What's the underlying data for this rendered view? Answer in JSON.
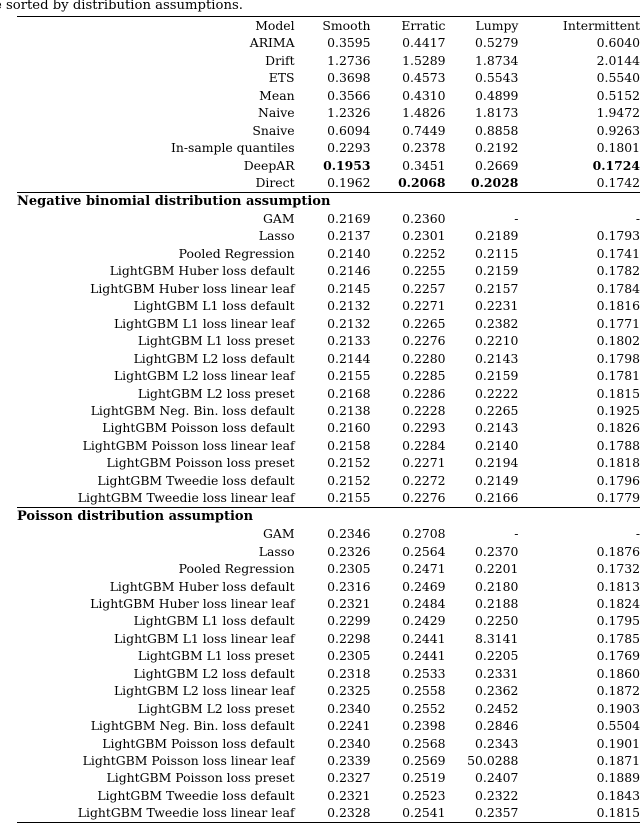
{
  "caption": {
    "text": "e sorted by distribution assumptions."
  },
  "table": {
    "columns": [
      {
        "key": "model",
        "label": "Model",
        "align": "right"
      },
      {
        "key": "smooth",
        "label": "Smooth",
        "align": "right"
      },
      {
        "key": "erratic",
        "label": "Erratic",
        "align": "right"
      },
      {
        "key": "lumpy",
        "label": "Lumpy",
        "align": "right"
      },
      {
        "key": "intermittent",
        "label": "Intermittent",
        "align": "right"
      }
    ],
    "sections": [
      {
        "heading": null,
        "rows": [
          {
            "model": "ARIMA",
            "smooth": "0.3595",
            "erratic": "0.4417",
            "lumpy": "0.5279",
            "intermittent": "0.6040",
            "bold": []
          },
          {
            "model": "Drift",
            "smooth": "1.2736",
            "erratic": "1.5289",
            "lumpy": "1.8734",
            "intermittent": "2.0144",
            "bold": []
          },
          {
            "model": "ETS",
            "smooth": "0.3698",
            "erratic": "0.4573",
            "lumpy": "0.5543",
            "intermittent": "0.5540",
            "bold": []
          },
          {
            "model": "Mean",
            "smooth": "0.3566",
            "erratic": "0.4310",
            "lumpy": "0.4899",
            "intermittent": "0.5152",
            "bold": []
          },
          {
            "model": "Naive",
            "smooth": "1.2326",
            "erratic": "1.4826",
            "lumpy": "1.8173",
            "intermittent": "1.9472",
            "bold": []
          },
          {
            "model": "Snaive",
            "smooth": "0.6094",
            "erratic": "0.7449",
            "lumpy": "0.8858",
            "intermittent": "0.9263",
            "bold": []
          },
          {
            "model": "In-sample quantiles",
            "smooth": "0.2293",
            "erratic": "0.2378",
            "lumpy": "0.2192",
            "intermittent": "0.1801",
            "bold": []
          },
          {
            "model": "DeepAR",
            "smooth": "0.1953",
            "erratic": "0.3451",
            "lumpy": "0.2669",
            "intermittent": "0.1724",
            "bold": [
              "smooth",
              "intermittent"
            ]
          },
          {
            "model": "Direct",
            "smooth": "0.1962",
            "erratic": "0.2068",
            "lumpy": "0.2028",
            "intermittent": "0.1742",
            "bold": [
              "erratic",
              "lumpy"
            ]
          }
        ]
      },
      {
        "heading": "Negative binomial distribution assumption",
        "rows": [
          {
            "model": "GAM",
            "smooth": "0.2169",
            "erratic": "0.2360",
            "lumpy": "-",
            "intermittent": "-",
            "bold": []
          },
          {
            "model": "Lasso",
            "smooth": "0.2137",
            "erratic": "0.2301",
            "lumpy": "0.2189",
            "intermittent": "0.1793",
            "bold": []
          },
          {
            "model": "Pooled Regression",
            "smooth": "0.2140",
            "erratic": "0.2252",
            "lumpy": "0.2115",
            "intermittent": "0.1741",
            "bold": []
          },
          {
            "model": "LightGBM Huber loss default",
            "smooth": "0.2146",
            "erratic": "0.2255",
            "lumpy": "0.2159",
            "intermittent": "0.1782",
            "bold": []
          },
          {
            "model": "LightGBM Huber loss linear leaf",
            "smooth": "0.2145",
            "erratic": "0.2257",
            "lumpy": "0.2157",
            "intermittent": "0.1784",
            "bold": []
          },
          {
            "model": "LightGBM L1 loss default",
            "smooth": "0.2132",
            "erratic": "0.2271",
            "lumpy": "0.2231",
            "intermittent": "0.1816",
            "bold": []
          },
          {
            "model": "LightGBM L1 loss linear leaf",
            "smooth": "0.2132",
            "erratic": "0.2265",
            "lumpy": "0.2382",
            "intermittent": "0.1771",
            "bold": []
          },
          {
            "model": "LightGBM L1 loss preset",
            "smooth": "0.2133",
            "erratic": "0.2276",
            "lumpy": "0.2210",
            "intermittent": "0.1802",
            "bold": []
          },
          {
            "model": "LightGBM L2 loss default",
            "smooth": "0.2144",
            "erratic": "0.2280",
            "lumpy": "0.2143",
            "intermittent": "0.1798",
            "bold": []
          },
          {
            "model": "LightGBM L2 loss linear leaf",
            "smooth": "0.2155",
            "erratic": "0.2285",
            "lumpy": "0.2159",
            "intermittent": "0.1781",
            "bold": []
          },
          {
            "model": "LightGBM L2 loss preset",
            "smooth": "0.2168",
            "erratic": "0.2286",
            "lumpy": "0.2222",
            "intermittent": "0.1815",
            "bold": []
          },
          {
            "model": "LightGBM Neg. Bin. loss default",
            "smooth": "0.2138",
            "erratic": "0.2228",
            "lumpy": "0.2265",
            "intermittent": "0.1925",
            "bold": []
          },
          {
            "model": "LightGBM Poisson loss default",
            "smooth": "0.2160",
            "erratic": "0.2293",
            "lumpy": "0.2143",
            "intermittent": "0.1826",
            "bold": []
          },
          {
            "model": "LightGBM Poisson loss linear leaf",
            "smooth": "0.2158",
            "erratic": "0.2284",
            "lumpy": "0.2140",
            "intermittent": "0.1788",
            "bold": []
          },
          {
            "model": "LightGBM Poisson loss preset",
            "smooth": "0.2152",
            "erratic": "0.2271",
            "lumpy": "0.2194",
            "intermittent": "0.1818",
            "bold": []
          },
          {
            "model": "LightGBM Tweedie loss default",
            "smooth": "0.2152",
            "erratic": "0.2272",
            "lumpy": "0.2149",
            "intermittent": "0.1796",
            "bold": []
          },
          {
            "model": "LightGBM Tweedie loss linear leaf",
            "smooth": "0.2155",
            "erratic": "0.2276",
            "lumpy": "0.2166",
            "intermittent": "0.1779",
            "bold": []
          }
        ]
      },
      {
        "heading": "Poisson distribution assumption",
        "rows": [
          {
            "model": "GAM",
            "smooth": "0.2346",
            "erratic": "0.2708",
            "lumpy": "-",
            "intermittent": "-",
            "bold": []
          },
          {
            "model": "Lasso",
            "smooth": "0.2326",
            "erratic": "0.2564",
            "lumpy": "0.2370",
            "intermittent": "0.1876",
            "bold": []
          },
          {
            "model": "Pooled Regression",
            "smooth": "0.2305",
            "erratic": "0.2471",
            "lumpy": "0.2201",
            "intermittent": "0.1732",
            "bold": []
          },
          {
            "model": "LightGBM Huber loss default",
            "smooth": "0.2316",
            "erratic": "0.2469",
            "lumpy": "0.2180",
            "intermittent": "0.1813",
            "bold": []
          },
          {
            "model": "LightGBM Huber loss linear leaf",
            "smooth": "0.2321",
            "erratic": "0.2484",
            "lumpy": "0.2188",
            "intermittent": "0.1824",
            "bold": []
          },
          {
            "model": "LightGBM L1 loss default",
            "smooth": "0.2299",
            "erratic": "0.2429",
            "lumpy": "0.2250",
            "intermittent": "0.1795",
            "bold": []
          },
          {
            "model": "LightGBM L1 loss linear leaf",
            "smooth": "0.2298",
            "erratic": "0.2441",
            "lumpy": "8.3141",
            "intermittent": "0.1785",
            "bold": []
          },
          {
            "model": "LightGBM L1 loss preset",
            "smooth": "0.2305",
            "erratic": "0.2441",
            "lumpy": "0.2205",
            "intermittent": "0.1769",
            "bold": []
          },
          {
            "model": "LightGBM L2 loss default",
            "smooth": "0.2318",
            "erratic": "0.2533",
            "lumpy": "0.2331",
            "intermittent": "0.1860",
            "bold": []
          },
          {
            "model": "LightGBM L2 loss linear leaf",
            "smooth": "0.2325",
            "erratic": "0.2558",
            "lumpy": "0.2362",
            "intermittent": "0.1872",
            "bold": []
          },
          {
            "model": "LightGBM L2 loss preset",
            "smooth": "0.2340",
            "erratic": "0.2552",
            "lumpy": "0.2452",
            "intermittent": "0.1903",
            "bold": []
          },
          {
            "model": "LightGBM Neg. Bin. loss default",
            "smooth": "0.2241",
            "erratic": "0.2398",
            "lumpy": "0.2846",
            "intermittent": "0.5504",
            "bold": []
          },
          {
            "model": "LightGBM Poisson loss default",
            "smooth": "0.2340",
            "erratic": "0.2568",
            "lumpy": "0.2343",
            "intermittent": "0.1901",
            "bold": []
          },
          {
            "model": "LightGBM Poisson loss linear leaf",
            "smooth": "0.2339",
            "erratic": "0.2569",
            "lumpy": "50.0288",
            "intermittent": "0.1871",
            "bold": []
          },
          {
            "model": "LightGBM Poisson loss preset",
            "smooth": "0.2327",
            "erratic": "0.2519",
            "lumpy": "0.2407",
            "intermittent": "0.1889",
            "bold": []
          },
          {
            "model": "LightGBM Tweedie loss default",
            "smooth": "0.2321",
            "erratic": "0.2523",
            "lumpy": "0.2322",
            "intermittent": "0.1843",
            "bold": []
          },
          {
            "model": "LightGBM Tweedie loss linear leaf",
            "smooth": "0.2328",
            "erratic": "0.2541",
            "lumpy": "0.2357",
            "intermittent": "0.1815",
            "bold": []
          }
        ]
      }
    ]
  }
}
